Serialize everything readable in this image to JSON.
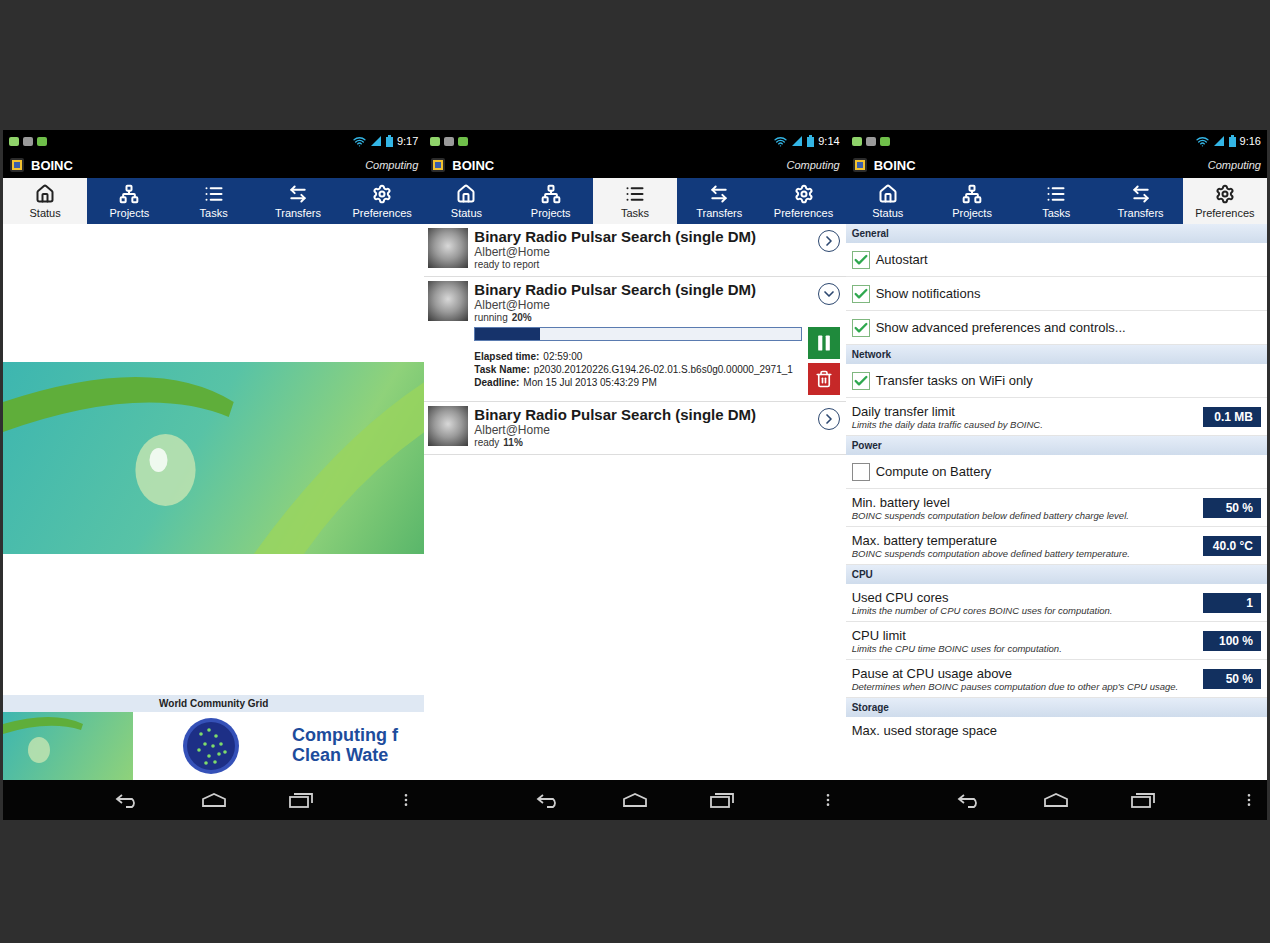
{
  "screens": [
    {
      "status_bar": {
        "time": "9:17"
      },
      "app_bar": {
        "title": "BOINC",
        "status": "Computing"
      },
      "tabs": [
        {
          "label": "Status",
          "selected": true
        },
        {
          "label": "Projects",
          "selected": false
        },
        {
          "label": "Tasks",
          "selected": false
        },
        {
          "label": "Transfers",
          "selected": false
        },
        {
          "label": "Preferences",
          "selected": false
        }
      ],
      "view": {
        "kind": "status",
        "banner": {
          "title": "World Community Grid",
          "lines": [
            "Computing f",
            "Clean Wate"
          ]
        }
      }
    },
    {
      "status_bar": {
        "time": "9:14"
      },
      "app_bar": {
        "title": "BOINC",
        "status": "Computing"
      },
      "tabs": [
        {
          "label": "Status",
          "selected": false
        },
        {
          "label": "Projects",
          "selected": false
        },
        {
          "label": "Tasks",
          "selected": true
        },
        {
          "label": "Transfers",
          "selected": false
        },
        {
          "label": "Preferences",
          "selected": false
        }
      ],
      "view": {
        "kind": "tasks",
        "tasks": [
          {
            "name": "Binary Radio Pulsar Search (single DM)",
            "project": "Albert@Home",
            "status": "ready to report",
            "expanded": false
          },
          {
            "name": "Binary Radio Pulsar Search (single DM)",
            "project": "Albert@Home",
            "status": "running",
            "percent": "20%",
            "expanded": true,
            "level": 0.2,
            "details": [
              {
                "label": "Elapsed time:",
                "value": "02:59:00"
              },
              {
                "label": "Task Name:",
                "value": "p2030.20120226.G194.26-02.01.S.b6s0g0.00000_2971_1"
              },
              {
                "label": "Deadline:",
                "value": "Mon 15 Jul 2013 05:43:29 PM"
              }
            ]
          },
          {
            "name": "Binary Radio Pulsar Search (single DM)",
            "project": "Albert@Home",
            "status": "ready",
            "percent": "11%",
            "expanded": false
          }
        ]
      }
    },
    {
      "status_bar": {
        "time": "9:16"
      },
      "app_bar": {
        "title": "BOINC",
        "status": "Computing"
      },
      "tabs": [
        {
          "label": "Status",
          "selected": false
        },
        {
          "label": "Projects",
          "selected": false
        },
        {
          "label": "Tasks",
          "selected": false
        },
        {
          "label": "Transfers",
          "selected": false
        },
        {
          "label": "Preferences",
          "selected": true
        }
      ],
      "view": {
        "kind": "preferences",
        "sections": [
          {
            "title": "General",
            "items": [
              {
                "kind": "checkbox",
                "label": "Autostart",
                "checked": true
              },
              {
                "kind": "checkbox",
                "label": "Show notifications",
                "checked": true
              },
              {
                "kind": "checkbox",
                "label": "Show advanced preferences and controls...",
                "checked": true
              }
            ]
          },
          {
            "title": "Network",
            "items": [
              {
                "kind": "checkbox",
                "label": "Transfer tasks on WiFi only",
                "checked": true
              },
              {
                "kind": "value",
                "label": "Daily transfer limit",
                "description": "Limits the daily data traffic caused by BOINC.",
                "value": "0.1 MB"
              }
            ]
          },
          {
            "title": "Power",
            "items": [
              {
                "kind": "checkbox",
                "label": "Compute on Battery",
                "checked": false
              },
              {
                "kind": "value",
                "label": "Min. battery level",
                "description": "BOINC suspends computation below defined battery charge level.",
                "value": "50 %"
              },
              {
                "kind": "value",
                "label": "Max. battery temperature",
                "description": "BOINC suspends computation above defined battery temperature.",
                "value": "40.0 °C"
              }
            ]
          },
          {
            "title": "CPU",
            "items": [
              {
                "kind": "value",
                "label": "Used CPU cores",
                "description": "Limits the number of CPU cores BOINC uses for computation.",
                "value": "1"
              },
              {
                "kind": "value",
                "label": "CPU limit",
                "description": "Limits the CPU time BOINC uses for computation.",
                "value": "100 %"
              },
              {
                "kind": "value",
                "label": "Pause at CPU usage above",
                "description": "Determines when BOINC pauses computation due to other app's CPU usage.",
                "value": "50 %"
              }
            ]
          },
          {
            "title": "Storage",
            "items": [
              {
                "kind": "label",
                "label": "Max. used storage space"
              }
            ]
          }
        ]
      }
    }
  ]
}
